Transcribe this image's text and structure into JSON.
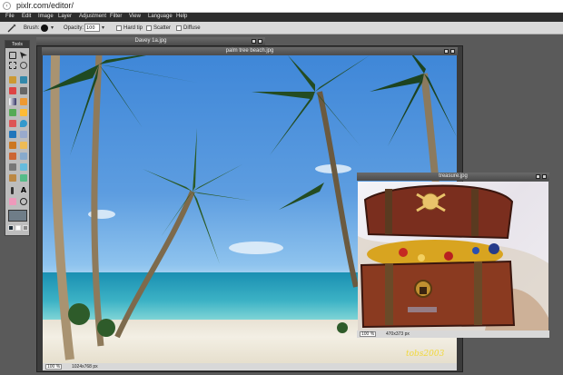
{
  "browser": {
    "url": "pixlr.com/editor/"
  },
  "menu": [
    "File",
    "Edit",
    "Image",
    "Layer",
    "Adjustment",
    "Filter",
    "View",
    "Language",
    "Help"
  ],
  "options": {
    "brush_label": "Brush:",
    "opacity_label": "Opacity:",
    "opacity_value": "100",
    "hard_tip_label": "Hard tip",
    "scatter_label": "Scatter",
    "diffuse_label": "Diffuse"
  },
  "tools_panel": {
    "title": "Tools"
  },
  "windows": {
    "davey": {
      "title": "Davey 1a.jpg"
    },
    "beach": {
      "title": "palm tree beach.jpg",
      "zoom": "100",
      "zoom_unit": "%",
      "size": "1024x768 px"
    },
    "treasure": {
      "title": "treasure.jpg",
      "zoom": "100",
      "zoom_unit": "%",
      "size": "470x373 px"
    }
  },
  "watermark": "tobs2003",
  "colors": {
    "menubar": "#2d2d2d",
    "workspace": "#5a5a5a",
    "primary_swatch": "#6f7d88",
    "secondary_swatch": "#1f2d38"
  },
  "icons": [
    "back-arrow-icon",
    "wand-icon",
    "brush-dot-icon",
    "minimize-icon",
    "maximize-icon",
    "close-icon"
  ]
}
